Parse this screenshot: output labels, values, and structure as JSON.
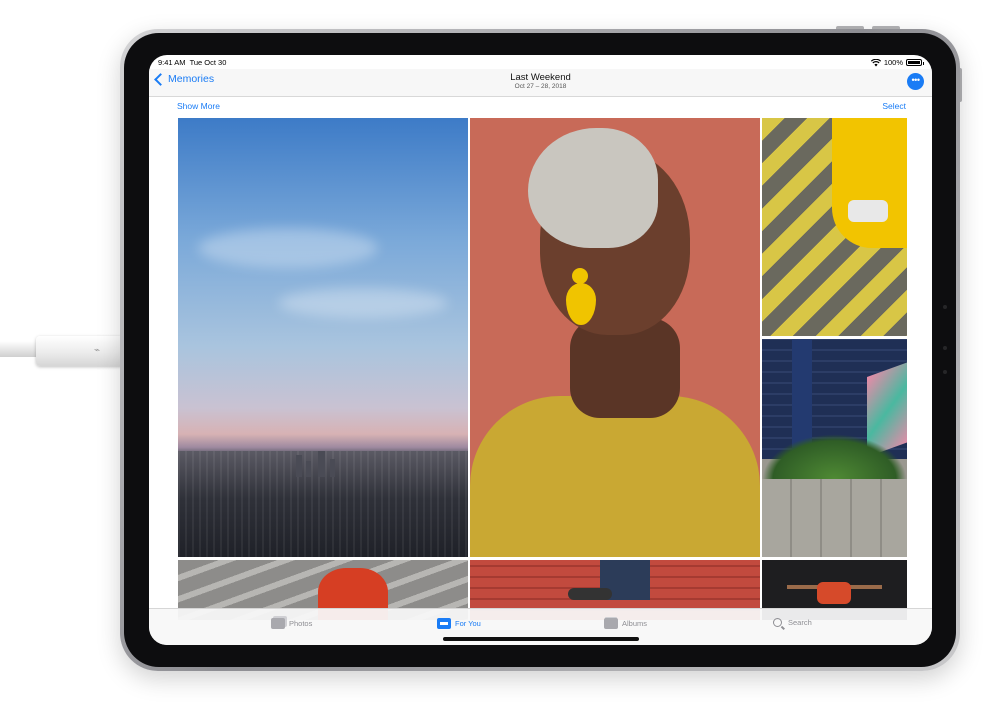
{
  "status_bar": {
    "time": "9:41 AM",
    "date": "Tue Oct 30",
    "battery": "100%",
    "battery_level": 1.0,
    "icons": [
      "wifi-icon",
      "battery-icon"
    ]
  },
  "nav": {
    "back_label": "Memories",
    "title": "Last Weekend",
    "subtitle": "Oct 27 – 28, 2018",
    "more_icon": "ellipsis-icon"
  },
  "toolbar": {
    "show_more_label": "Show More",
    "select_label": "Select"
  },
  "photos": [
    {
      "id": "city-skyline"
    },
    {
      "id": "woman-portrait"
    },
    {
      "id": "yellow-taxi"
    },
    {
      "id": "brick-wall"
    },
    {
      "id": "stairs-person"
    },
    {
      "id": "red-bricks"
    },
    {
      "id": "dancer"
    }
  ],
  "tabs": [
    {
      "label": "Photos",
      "icon": "photos-icon",
      "active": false
    },
    {
      "label": "For You",
      "icon": "for-you-icon",
      "active": true
    },
    {
      "label": "Albums",
      "icon": "albums-icon",
      "active": false
    },
    {
      "label": "Search",
      "icon": "search-icon",
      "active": false
    }
  ],
  "colors": {
    "accent": "#1a7cf5",
    "inactive_tab": "#8e8e93",
    "device_frame": "#0d0d0f"
  }
}
